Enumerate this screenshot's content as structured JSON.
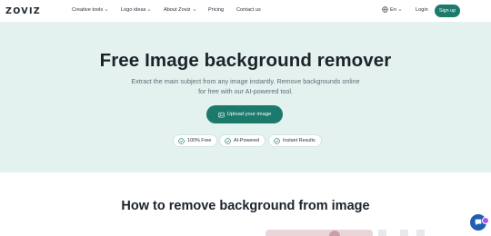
{
  "nav": {
    "logo": "ZOVIZ",
    "items": [
      {
        "label": "Creative tools",
        "dropdown": true
      },
      {
        "label": "Logo ideas",
        "dropdown": true
      },
      {
        "label": "About Zoviz",
        "dropdown": true
      },
      {
        "label": "Pricing",
        "dropdown": false
      },
      {
        "label": "Contact us",
        "dropdown": false
      }
    ],
    "language": "En",
    "login": "Login",
    "signup": "Sign up"
  },
  "hero": {
    "title": "Free Image background remover",
    "subtitle": "Extract the main subject from any image instantly. Remove backgrounds online for free with our AI-powered tool.",
    "upload_label": "Upload your image",
    "badges": [
      "100% Free",
      "AI-Powered",
      "Instant Results"
    ]
  },
  "section": {
    "title": "How to remove background from image"
  },
  "colors": {
    "accent": "#1b7a6c",
    "hero_bg": "#e3f2ef",
    "chat_bubble": "#1e5fb3"
  },
  "icons": {
    "language": "globe-icon",
    "upload": "image-upload-icon",
    "badge": "check-circle-icon",
    "chat": "chat-icon"
  }
}
